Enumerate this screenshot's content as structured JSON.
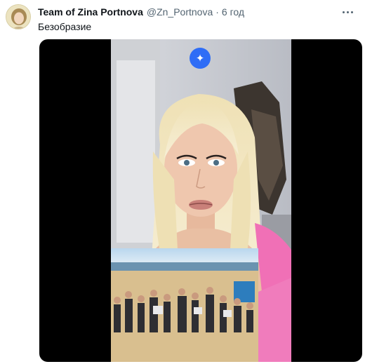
{
  "post": {
    "author_name": "Team of Zina Portnova",
    "author_handle": "@Zn_Portnova",
    "separator": "·",
    "time": "6 год",
    "text": "Безобразие"
  },
  "media": {
    "type": "video",
    "badge_icon": "sparkle-icon",
    "badge_glyph": "✦"
  },
  "colors": {
    "text_primary": "#0f1419",
    "text_secondary": "#536471",
    "badge_blue": "#2f6df6"
  }
}
